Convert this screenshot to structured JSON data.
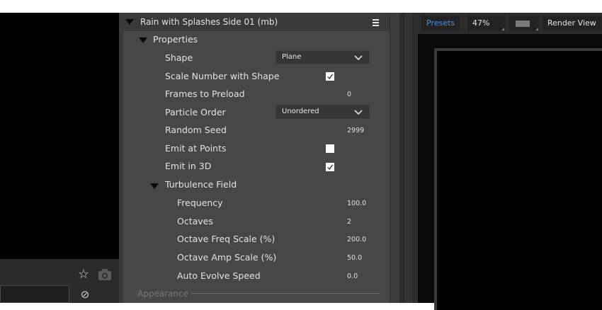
{
  "panel": {
    "layer_title": "Rain with Splashes Side 01 (mb)",
    "group_properties": "Properties",
    "rows": [
      {
        "label": "Shape",
        "value": "Plane"
      },
      {
        "label": "Scale Number with Shape",
        "checked": true
      },
      {
        "label": "Frames to Preload",
        "value": "0"
      },
      {
        "label": "Particle Order",
        "value": "Unordered"
      },
      {
        "label": "Random Seed",
        "value": "2999"
      },
      {
        "label": "Emit at Points",
        "checked": false
      },
      {
        "label": "Emit in 3D",
        "checked": true
      }
    ],
    "turbulence": {
      "title": "Turbulence Field",
      "rows": [
        {
          "label": "Frequency",
          "value": "100.0"
        },
        {
          "label": "Octaves",
          "value": "2"
        },
        {
          "label": "Octave Freq Scale (%)",
          "value": "200.0"
        },
        {
          "label": "Octave Amp Scale (%)",
          "value": "50.0"
        },
        {
          "label": "Auto Evolve Speed",
          "value": "0.0"
        }
      ]
    },
    "next_section": "Appearance"
  },
  "viewer_toolbar": {
    "presets": "Presets",
    "zoom": "47%",
    "render_view": "Render View",
    "presets_color": "#4a90d9"
  },
  "icons": {
    "star": "star-icon",
    "camera": "camera-icon",
    "disable": "disable-icon",
    "menu": "hamburger-menu-icon"
  }
}
